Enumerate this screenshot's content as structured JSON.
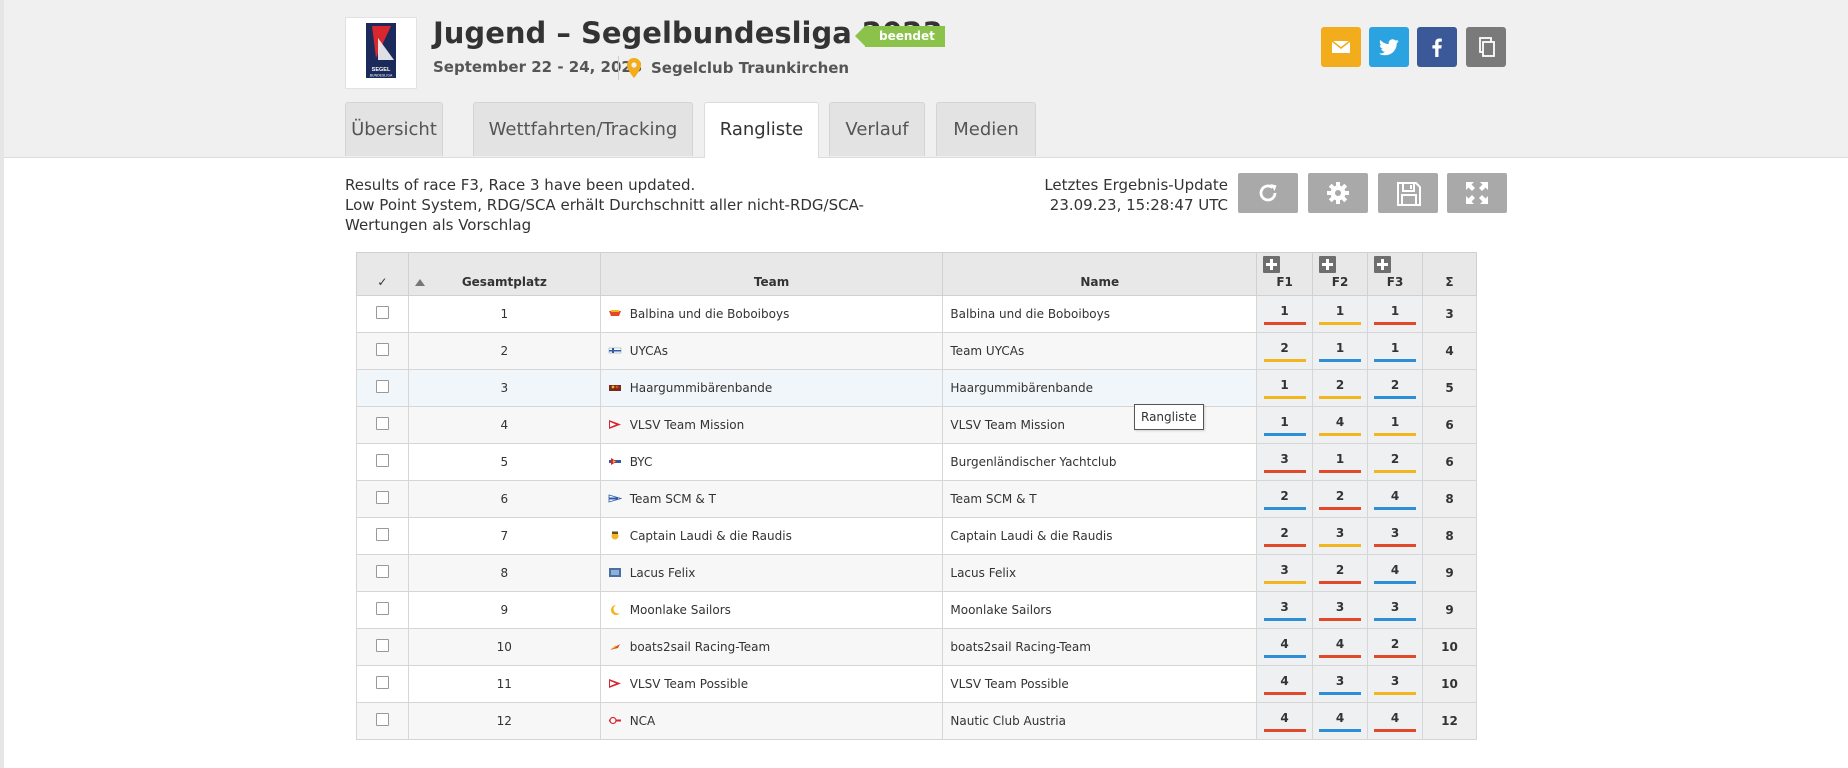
{
  "event": {
    "title": "Jugend – Segelbundesliga 2023",
    "status_badge": "beendet",
    "dates": "September 22 - 24, 2023",
    "venue": "Segelclub Traunkirchen"
  },
  "share_icons": [
    "mail-icon",
    "twitter-icon",
    "facebook-icon",
    "copy-icon"
  ],
  "tabs": [
    {
      "label": "Übersicht",
      "active": false
    },
    {
      "label": "Wettfahrten/Tracking",
      "active": false
    },
    {
      "label": "Rangliste",
      "active": true
    },
    {
      "label": "Verlauf",
      "active": false
    },
    {
      "label": "Medien",
      "active": false
    }
  ],
  "info": {
    "line1": "Results of race F3, Race 3 have been updated.",
    "line2": "Low Point System, RDG/SCA erhält Durchschnitt aller nicht-RDG/SCA-Wertungen als Vorschlag",
    "update_label": "Letztes Ergebnis-Update",
    "update_time": "23.09.23, 15:28:47 UTC"
  },
  "toolbar_icons": [
    "refresh-icon",
    "settings-icon",
    "save-icon",
    "fullscreen-icon"
  ],
  "table": {
    "headers": {
      "check": "✓",
      "rank": "Gesamtplatz",
      "team": "Team",
      "name": "Name",
      "f1": "F1",
      "f2": "F2",
      "f3": "F3",
      "sum": "Σ"
    },
    "rows": [
      {
        "rank": "1",
        "team": "Balbina und die Boboiboys",
        "name": "Balbina und die Boboiboys",
        "f1": "1",
        "f2": "1",
        "f3": "1",
        "sum": "3"
      },
      {
        "rank": "2",
        "team": "UYCAs",
        "name": "Team UYCAs",
        "f1": "2",
        "f2": "1",
        "f3": "1",
        "sum": "4"
      },
      {
        "rank": "3",
        "team": "Haargummibärenbande",
        "name": "Haargummibärenbande",
        "f1": "1",
        "f2": "2",
        "f3": "2",
        "sum": "5"
      },
      {
        "rank": "4",
        "team": "VLSV Team Mission",
        "name": "VLSV Team Mission",
        "f1": "1",
        "f2": "4",
        "f3": "1",
        "sum": "6"
      },
      {
        "rank": "5",
        "team": "BYC",
        "name": "Burgenländischer Yachtclub",
        "f1": "3",
        "f2": "1",
        "f3": "2",
        "sum": "6"
      },
      {
        "rank": "6",
        "team": "Team SCM & T",
        "name": "Team SCM & T",
        "f1": "2",
        "f2": "2",
        "f3": "4",
        "sum": "8"
      },
      {
        "rank": "7",
        "team": "Captain Laudi & die Raudis",
        "name": "Captain Laudi & die Raudis",
        "f1": "2",
        "f2": "3",
        "f3": "3",
        "sum": "8"
      },
      {
        "rank": "8",
        "team": "Lacus Felix",
        "name": "Lacus Felix",
        "f1": "3",
        "f2": "2",
        "f3": "4",
        "sum": "9"
      },
      {
        "rank": "9",
        "team": "Moonlake Sailors",
        "name": "Moonlake Sailors",
        "f1": "3",
        "f2": "3",
        "f3": "3",
        "sum": "9"
      },
      {
        "rank": "10",
        "team": "boats2sail Racing-Team",
        "name": "boats2sail Racing-Team",
        "f1": "4",
        "f2": "4",
        "f3": "2",
        "sum": "10"
      },
      {
        "rank": "11",
        "team": "VLSV Team Possible",
        "name": "VLSV Team Possible",
        "f1": "4",
        "f2": "3",
        "f3": "3",
        "sum": "10"
      },
      {
        "rank": "12",
        "team": "NCA",
        "name": "Nautic Club Austria",
        "f1": "4",
        "f2": "4",
        "f3": "4",
        "sum": "12"
      }
    ]
  },
  "tooltip": "Rangliste",
  "colors": {
    "badge": "#8bc34a",
    "mail": "#f2ac1c",
    "twitter": "#2aa3e0",
    "facebook": "#3b5998",
    "copy": "#7a7a7a",
    "fleet_red": "#e04a2a",
    "fleet_yellow": "#f2b621",
    "fleet_blue": "#2e8fd6"
  }
}
